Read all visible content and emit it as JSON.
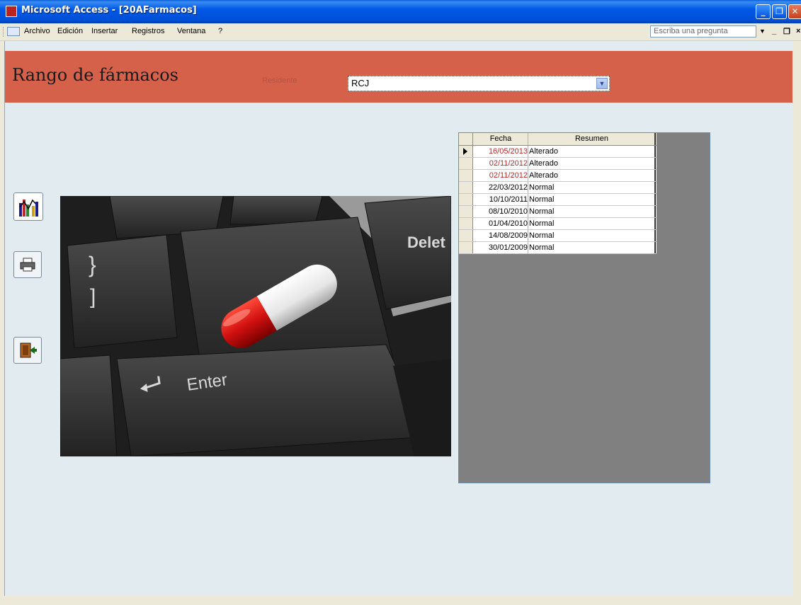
{
  "window": {
    "title": "Microsoft Access - [20AFarmacos]"
  },
  "menu": {
    "items": [
      "Archivo",
      "Edición",
      "Insertar",
      "Registros",
      "Ventana",
      "?"
    ],
    "ask_placeholder": "Escriba una pregunta"
  },
  "form": {
    "title": "Rango de fármacos",
    "field_label": "Residente",
    "combo_value": "RCJ"
  },
  "datasheet": {
    "columns": [
      "Fecha",
      "Resumen"
    ],
    "rows": [
      {
        "fecha": "16/05/2013",
        "resumen": "Alterado",
        "alert": true
      },
      {
        "fecha": "02/11/2012",
        "resumen": "Alterado",
        "alert": true
      },
      {
        "fecha": "02/11/2012",
        "resumen": "Alterado",
        "alert": true
      },
      {
        "fecha": "22/03/2012",
        "resumen": "Normal",
        "alert": false
      },
      {
        "fecha": "10/10/2011",
        "resumen": "Normal",
        "alert": false
      },
      {
        "fecha": "08/10/2010",
        "resumen": "Normal",
        "alert": false
      },
      {
        "fecha": "01/04/2010",
        "resumen": "Normal",
        "alert": false
      },
      {
        "fecha": "14/08/2009",
        "resumen": "Normal",
        "alert": false
      },
      {
        "fecha": "30/01/2009",
        "resumen": "Normal",
        "alert": false
      }
    ],
    "alert_color": "#c0282a"
  },
  "photo": {
    "key_labels": [
      "Enter",
      "Delet",
      "}",
      "]"
    ]
  },
  "colors": {
    "header_band": "#d5614b",
    "background": "#e1ebf0",
    "subform_bg": "#808080"
  },
  "icons": [
    "chart-icon",
    "print-icon",
    "exit-door-icon",
    "dropdown-arrow-icon"
  ]
}
